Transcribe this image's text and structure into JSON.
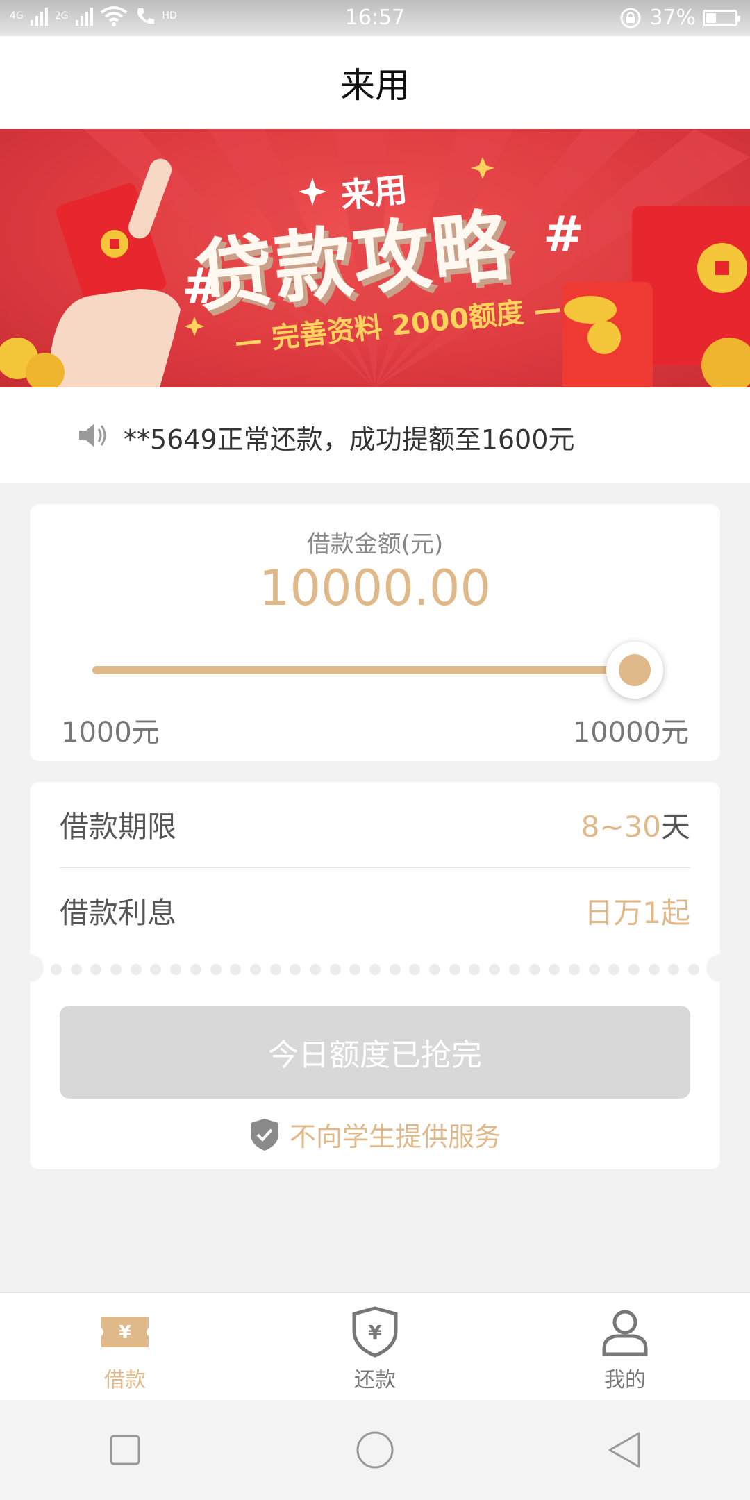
{
  "status_bar": {
    "network_1": "4G",
    "network_2": "2G",
    "hd": "HD",
    "time": "16:57",
    "battery": "37%"
  },
  "header": {
    "title": "来用"
  },
  "banner": {
    "brand": "来用",
    "headline": "贷款攻略",
    "hash_left": "#",
    "hash_right": "#",
    "subline": "— 完善资料 2000额度 —"
  },
  "notice": {
    "text": "**5649正常还款，成功提额至1600元"
  },
  "loan_amount": {
    "label": "借款金额(元)",
    "value": "10000.00",
    "min_label": "1000元",
    "max_label": "10000元",
    "slider_fraction": 1.0
  },
  "loan_terms": {
    "period_label": "借款期限",
    "period_value": "8~30",
    "period_unit": "天",
    "interest_label": "借款利息",
    "interest_value": "日万1起"
  },
  "action": {
    "button_label": "今日额度已抢完",
    "tip": "不向学生提供服务"
  },
  "tabs": [
    {
      "label": "借款",
      "icon": "ticket-yuan-icon",
      "active": true
    },
    {
      "label": "还款",
      "icon": "shield-yuan-icon",
      "active": false
    },
    {
      "label": "我的",
      "icon": "person-icon",
      "active": false
    }
  ],
  "colors": {
    "accent": "#e0b98a",
    "banner_red": "#dc3a3f",
    "disabled_button": "#d8d8d8"
  },
  "system_nav": {
    "icons": [
      "square-icon",
      "circle-icon",
      "back-triangle-icon"
    ]
  }
}
